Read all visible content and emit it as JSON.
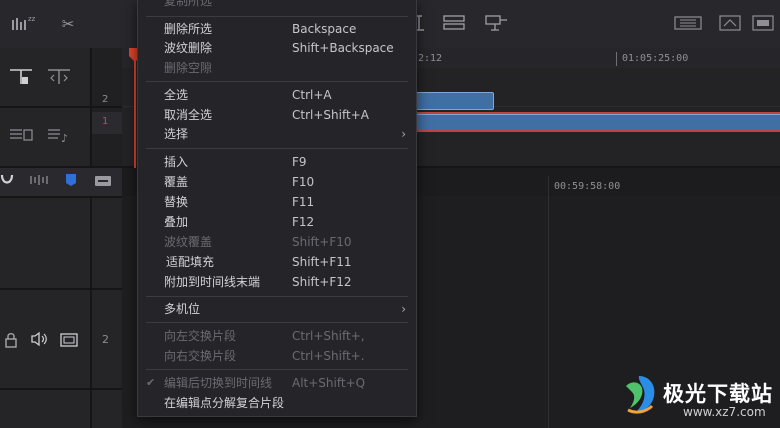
{
  "timeline": {
    "ruler_labels": [
      "2:12",
      "01:05:25:00",
      "00:59:58:00"
    ],
    "track_numbers": [
      "2",
      "1",
      "2"
    ]
  },
  "menu": {
    "items": [
      {
        "label": "复制所选",
        "shortcut": "",
        "disabled": true,
        "arrow": false
      },
      {
        "label": "删除所选",
        "shortcut": "Backspace",
        "disabled": false,
        "arrow": false
      },
      {
        "label": "波纹删除",
        "shortcut": "Shift+Backspace",
        "disabled": false,
        "arrow": false
      },
      {
        "label": "删除空隙",
        "shortcut": "",
        "disabled": true,
        "arrow": false
      },
      {
        "label": "全选",
        "shortcut": "Ctrl+A",
        "disabled": false,
        "arrow": false
      },
      {
        "label": "取消全选",
        "shortcut": "Ctrl+Shift+A",
        "disabled": false,
        "arrow": false
      },
      {
        "label": "选择",
        "shortcut": "",
        "disabled": false,
        "arrow": true
      },
      {
        "label": "插入",
        "shortcut": "F9",
        "disabled": false,
        "arrow": false
      },
      {
        "label": "覆盖",
        "shortcut": "F10",
        "disabled": false,
        "arrow": false
      },
      {
        "label": "替换",
        "shortcut": "F11",
        "disabled": false,
        "arrow": false
      },
      {
        "label": "叠加",
        "shortcut": "F12",
        "disabled": false,
        "arrow": false
      },
      {
        "label": "波纹覆盖",
        "shortcut": "Shift+F10",
        "disabled": true,
        "arrow": false
      },
      {
        "label": "适配填充",
        "shortcut": "Shift+F11",
        "disabled": false,
        "arrow": false
      },
      {
        "label": "附加到时间线末端",
        "shortcut": "Shift+F12",
        "disabled": false,
        "arrow": false
      },
      {
        "label": "多机位",
        "shortcut": "",
        "disabled": false,
        "arrow": true
      },
      {
        "label": "向左交换片段",
        "shortcut": "Ctrl+Shift+,",
        "disabled": true,
        "arrow": false
      },
      {
        "label": "向右交换片段",
        "shortcut": "Ctrl+Shift+.",
        "disabled": true,
        "arrow": false
      },
      {
        "label": "编辑后切换到时间线",
        "shortcut": "Alt+Shift+Q",
        "disabled": true,
        "arrow": false,
        "checked": true
      },
      {
        "label": "在编辑点分解复合片段",
        "shortcut": "",
        "disabled": false,
        "arrow": false
      }
    ],
    "submenu_arrow": "›",
    "check_mark": "✔"
  },
  "watermark": {
    "text": "极光下载站",
    "url": "www.xz7.com"
  },
  "colors": {
    "menu_bg": "#252529",
    "clip_blue": "#3f6fa3",
    "playhead": "#e1442c"
  }
}
